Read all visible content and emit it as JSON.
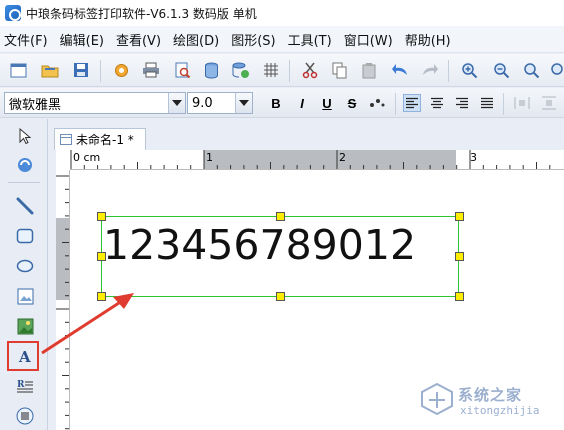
{
  "window": {
    "title": "中琅条码标签打印软件-V6.1.3 数码版 单机"
  },
  "menu": {
    "items": [
      "文件(F)",
      "编辑(E)",
      "查看(V)",
      "绘图(D)",
      "图形(S)",
      "工具(T)",
      "窗口(W)",
      "帮助(H)"
    ]
  },
  "font_toolbar": {
    "font_name": "微软雅黑",
    "font_size": "9.0",
    "bold": "B",
    "italic": "I",
    "underline": "U",
    "strike": "S"
  },
  "document": {
    "tab_label": "未命名-1 *"
  },
  "ruler": {
    "labels": [
      "0 cm",
      "1",
      "2",
      "3"
    ]
  },
  "canvas": {
    "text_object": "123456789012"
  },
  "watermark": {
    "text": "系统之家",
    "sub": "xitongzhijia"
  },
  "colors": {
    "selection": "#2ec42e",
    "handle": "#ffee00",
    "annotation": "#e03b2f"
  }
}
